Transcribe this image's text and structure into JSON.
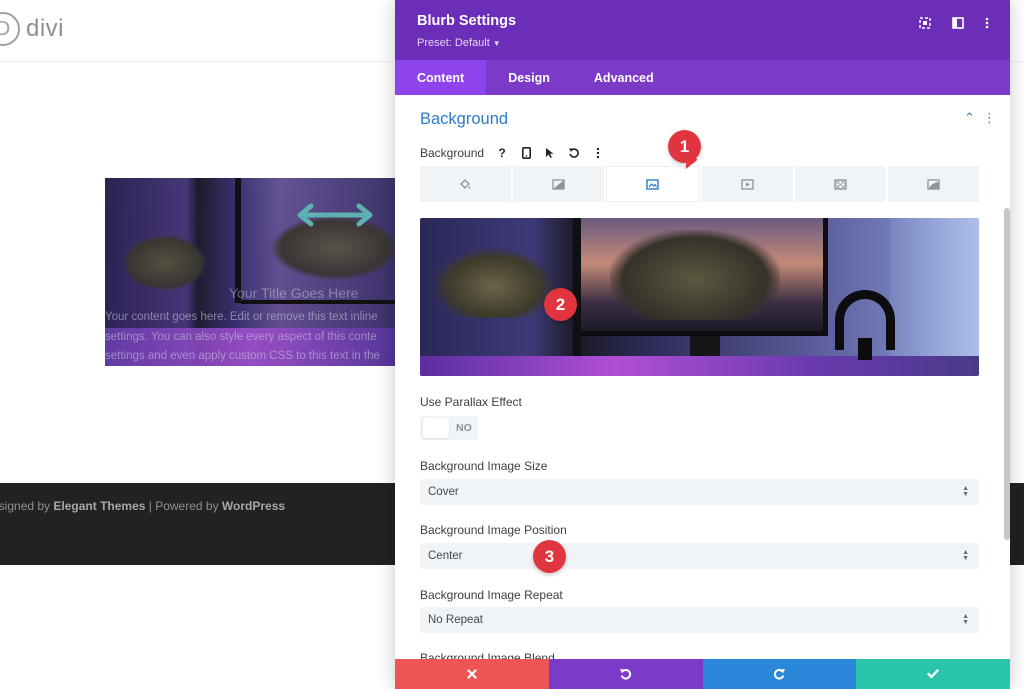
{
  "site": {
    "logo_letter": "D",
    "logo_text": "divi"
  },
  "blurb": {
    "title": "Your Title Goes Here",
    "text_lines": [
      "Your content goes here. Edit or remove this text inline",
      "settings. You can also style every aspect of this conte",
      "settings and even apply custom CSS to this text in the"
    ]
  },
  "footer": {
    "prefix": "esigned by ",
    "designer": "Elegant Themes",
    "separator": " | Powered by ",
    "platform": "WordPress"
  },
  "modal": {
    "title": "Blurb Settings",
    "preset": "Preset: Default",
    "tabs": [
      "Content",
      "Design",
      "Advanced"
    ],
    "active_tab": "Content",
    "group_title": "Background",
    "background_label": "Background",
    "background_help": "?",
    "background_type_icons": [
      "paint-bucket-icon",
      "gradient-icon",
      "image-icon",
      "video-icon",
      "pattern-icon",
      "mask-icon"
    ],
    "active_background_type": "image-icon",
    "parallax": {
      "label": "Use Parallax Effect",
      "value": "NO"
    },
    "image_size": {
      "label": "Background Image Size",
      "value": "Cover"
    },
    "image_position": {
      "label": "Background Image Position",
      "value": "Center"
    },
    "image_repeat": {
      "label": "Background Image Repeat",
      "value": "No Repeat"
    },
    "image_blend": {
      "label": "Background Image Blend"
    }
  },
  "callouts": [
    "1",
    "2",
    "3"
  ],
  "colors": {
    "header_purple": "#6c2eb9",
    "tabs_purple": "#7b3ac8",
    "active_tab_purple": "#8e44ec",
    "group_blue": "#2d7cc7",
    "callout_red": "#e0353f",
    "discard_red": "#ef5555",
    "redo_blue": "#2b87da",
    "save_teal": "#29c4a9"
  }
}
